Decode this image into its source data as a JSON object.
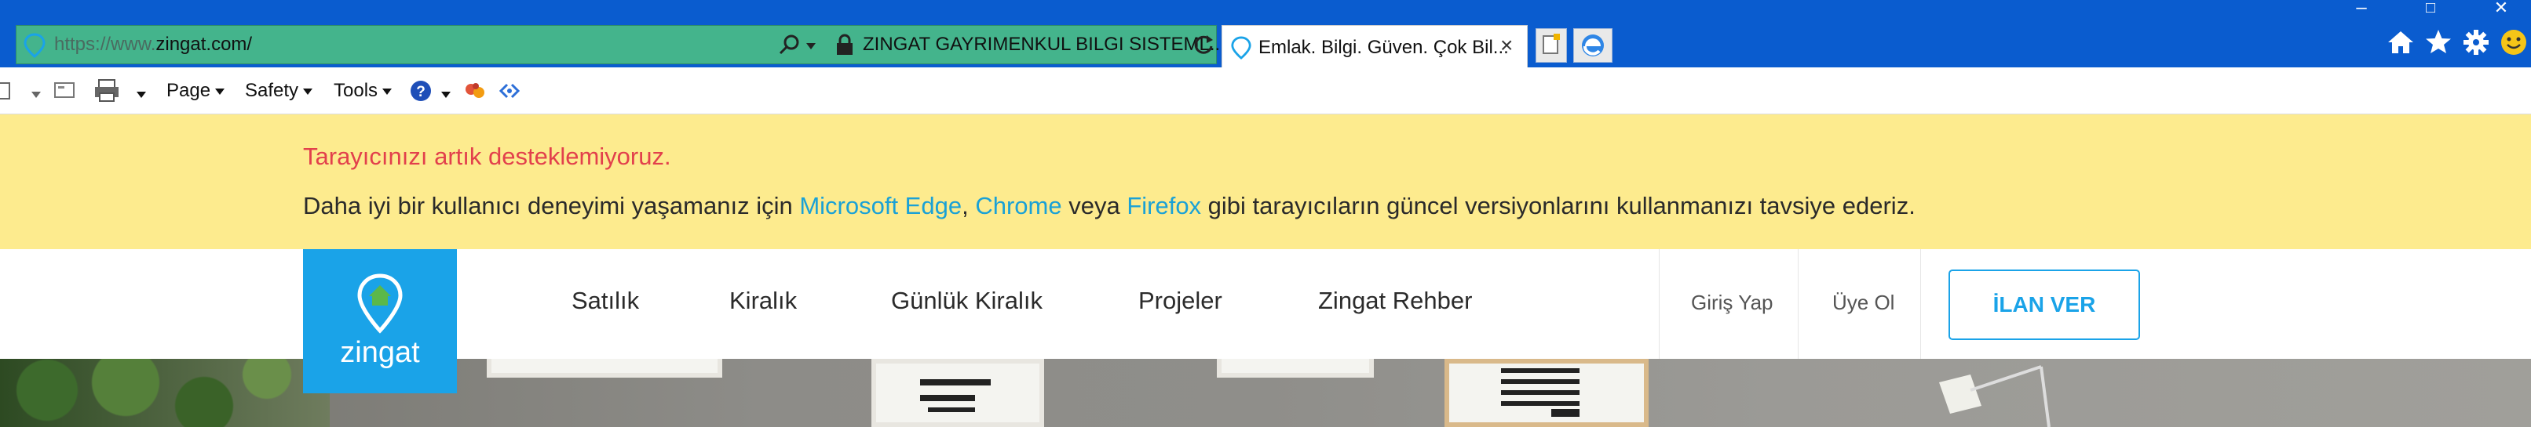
{
  "browser": {
    "address_url_prefix": "https://www.",
    "address_url_domain": "zingat.com/",
    "address_page_title": "ZINGAT GAYRIMENKUL BILGI SISTEML...",
    "tab_label": "Emlak. Bilgi. Güven. Çok Bil...",
    "window_controls": {
      "minimize": "–",
      "maximize": "□",
      "close": "✕"
    },
    "right_icons": [
      "home-icon",
      "favorites-star-icon",
      "settings-gear-icon",
      "smiley-feedback-icon"
    ]
  },
  "command_bar": {
    "page": "Page",
    "safety": "Safety",
    "tools": "Tools",
    "icons": [
      "feeds-icon",
      "read-mail-icon",
      "print-icon",
      "help-icon",
      "research-icon",
      "blog-icon"
    ]
  },
  "banner": {
    "warning": "Tarayıcınızı artık desteklemiyoruz.",
    "message_part1": "Daha iyi bir kullanıcı deneyimi yaşamanız için ",
    "link_edge": "Microsoft Edge",
    "comma": ", ",
    "link_chrome": "Chrome",
    "message_part2": " veya ",
    "link_firefox": "Firefox",
    "message_part3": " gibi tarayıcıların güncel versiyonlarını kullanmanızı tavsiye ederiz.",
    "colors": {
      "background": "#fdeb8e",
      "warning": "#e2404c",
      "link": "#1aa1d6"
    }
  },
  "site_header": {
    "logo_text": "zingat",
    "nav": [
      "Satılık",
      "Kiralık",
      "Günlük Kiralık",
      "Projeler",
      "Zingat Rehber"
    ],
    "login": "Giriş Yap",
    "register": "Üye Ol",
    "post_ad": "İLAN VER",
    "colors": {
      "brand": "#1aa3e8"
    }
  }
}
